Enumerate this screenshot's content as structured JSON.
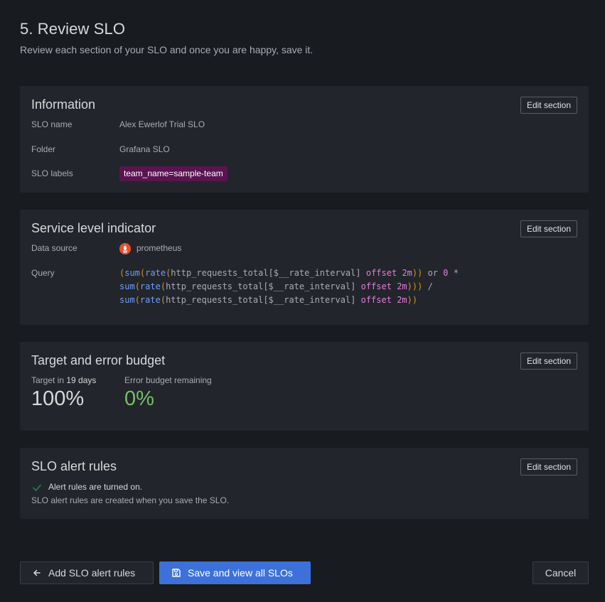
{
  "header": {
    "title": "5. Review SLO",
    "subtitle": "Review each section of your SLO and once you are happy, save it."
  },
  "information": {
    "title": "Information",
    "edit_label": "Edit section",
    "rows": [
      {
        "label": "SLO name",
        "value": "Alex Ewerlof Trial SLO"
      },
      {
        "label": "Folder",
        "value": "Grafana SLO"
      },
      {
        "label": "SLO labels",
        "value": "team_name=sample-team"
      }
    ]
  },
  "sli": {
    "title": "Service level indicator",
    "edit_label": "Edit section",
    "datasource_label": "Data source",
    "datasource_value": "prometheus",
    "datasource_icon": "prometheus-icon",
    "query_label": "Query",
    "query_lines": [
      "(sum(rate(http_requests_total[$__rate_interval] offset 2m)) or 0 *",
      "sum(rate(http_requests_total[$__rate_interval] offset 2m))) /",
      "sum(rate(http_requests_total[$__rate_interval] offset 2m))"
    ]
  },
  "target": {
    "title": "Target and error budget",
    "edit_label": "Edit section",
    "target_label_prefix": "Target in",
    "target_window": "19 days",
    "target_value": "100%",
    "budget_label": "Error budget remaining",
    "budget_value": "0%",
    "budget_color": "#73bf69"
  },
  "alerts": {
    "title": "SLO alert rules",
    "edit_label": "Edit section",
    "status": "Alert rules are turned on.",
    "note": "SLO alert rules are created when you save the SLO.",
    "check_color": "#1a7f4b"
  },
  "footer": {
    "back_label": "Add SLO alert rules",
    "save_label": "Save and view all SLOs",
    "cancel_label": "Cancel",
    "primary_color": "#3d71d9"
  }
}
